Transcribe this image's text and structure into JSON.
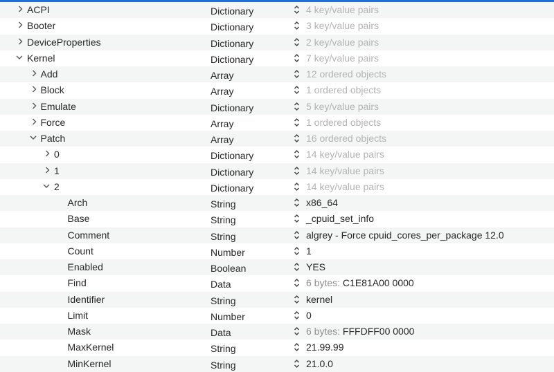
{
  "accent_color": "#1d6fe0",
  "rows": [
    {
      "key": "ACPI",
      "level": 0,
      "disclosure": "collapsed",
      "type": "Dictionary",
      "value": "4 key/value pairs",
      "summary": true
    },
    {
      "key": "Booter",
      "level": 0,
      "disclosure": "collapsed",
      "type": "Dictionary",
      "value": "3 key/value pairs",
      "summary": true
    },
    {
      "key": "DeviceProperties",
      "level": 0,
      "disclosure": "collapsed",
      "type": "Dictionary",
      "value": "2 key/value pairs",
      "summary": true
    },
    {
      "key": "Kernel",
      "level": 0,
      "disclosure": "expanded",
      "type": "Dictionary",
      "value": "7 key/value pairs",
      "summary": true
    },
    {
      "key": "Add",
      "level": 1,
      "disclosure": "collapsed",
      "type": "Array",
      "value": "12 ordered objects",
      "summary": true
    },
    {
      "key": "Block",
      "level": 1,
      "disclosure": "collapsed",
      "type": "Array",
      "value": "1 ordered objects",
      "summary": true
    },
    {
      "key": "Emulate",
      "level": 1,
      "disclosure": "collapsed",
      "type": "Dictionary",
      "value": "5 key/value pairs",
      "summary": true
    },
    {
      "key": "Force",
      "level": 1,
      "disclosure": "collapsed",
      "type": "Array",
      "value": "1 ordered objects",
      "summary": true
    },
    {
      "key": "Patch",
      "level": 1,
      "disclosure": "expanded",
      "type": "Array",
      "value": "16 ordered objects",
      "summary": true
    },
    {
      "key": "0",
      "level": 2,
      "disclosure": "collapsed",
      "type": "Dictionary",
      "value": "14 key/value pairs",
      "summary": true
    },
    {
      "key": "1",
      "level": 2,
      "disclosure": "collapsed",
      "type": "Dictionary",
      "value": "14 key/value pairs",
      "summary": true
    },
    {
      "key": "2",
      "level": 2,
      "disclosure": "expanded",
      "type": "Dictionary",
      "value": "14 key/value pairs",
      "summary": true
    },
    {
      "key": "Arch",
      "level": 3,
      "disclosure": "none",
      "type": "String",
      "value": "x86_64"
    },
    {
      "key": "Base",
      "level": 3,
      "disclosure": "none",
      "type": "String",
      "value": "_cpuid_set_info"
    },
    {
      "key": "Comment",
      "level": 3,
      "disclosure": "none",
      "type": "String",
      "value": "algrey - Force cpuid_cores_per_package 12.0"
    },
    {
      "key": "Count",
      "level": 3,
      "disclosure": "none",
      "type": "Number",
      "value": "1"
    },
    {
      "key": "Enabled",
      "level": 3,
      "disclosure": "none",
      "type": "Boolean",
      "value": "YES"
    },
    {
      "key": "Find",
      "level": 3,
      "disclosure": "none",
      "type": "Data",
      "prefix": "6 bytes:",
      "value": "C1E81A00 0000"
    },
    {
      "key": "Identifier",
      "level": 3,
      "disclosure": "none",
      "type": "String",
      "value": "kernel"
    },
    {
      "key": "Limit",
      "level": 3,
      "disclosure": "none",
      "type": "Number",
      "value": "0"
    },
    {
      "key": "Mask",
      "level": 3,
      "disclosure": "none",
      "type": "Data",
      "prefix": "6 bytes:",
      "value": "FFFDFF00 0000"
    },
    {
      "key": "MaxKernel",
      "level": 3,
      "disclosure": "none",
      "type": "String",
      "value": "21.99.99"
    },
    {
      "key": "MinKernel",
      "level": 3,
      "disclosure": "none",
      "type": "String",
      "value": "21.0.0"
    }
  ]
}
